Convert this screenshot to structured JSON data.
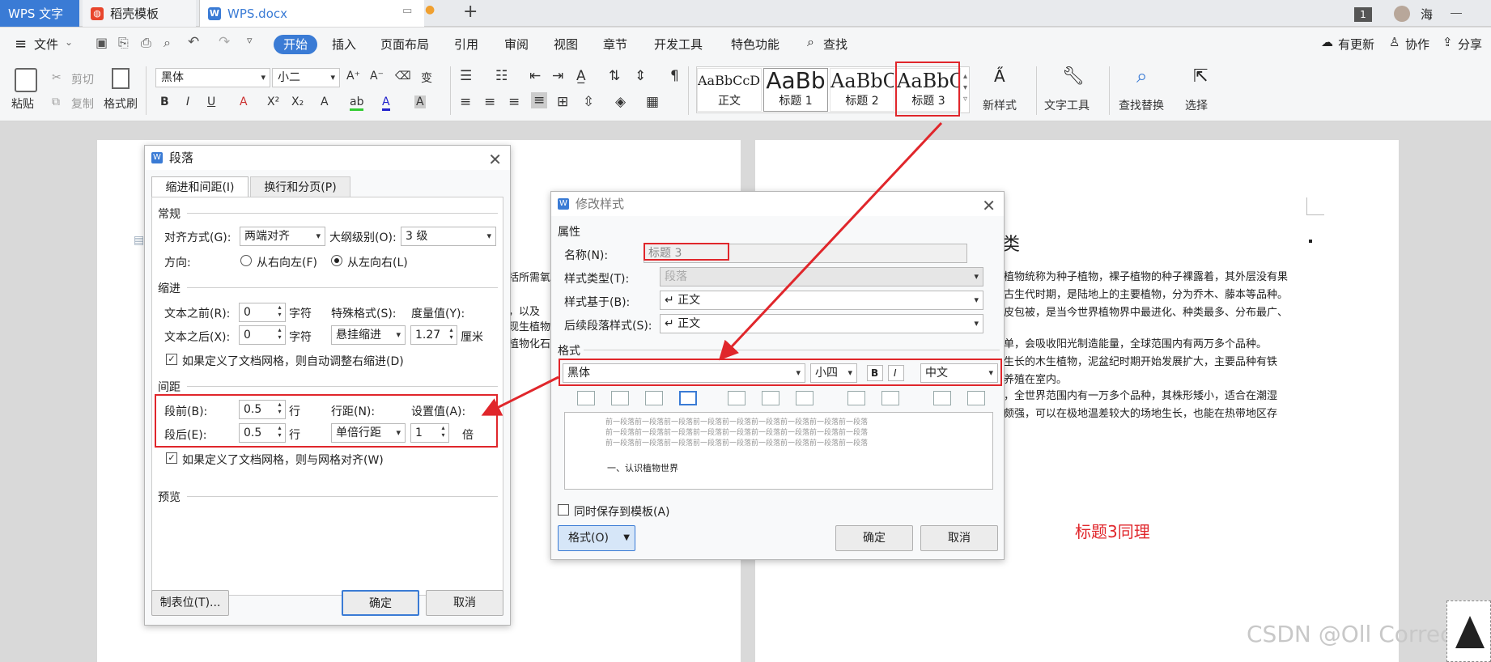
{
  "tabs": {
    "app": "WPS 文字",
    "template": "稻壳模板",
    "doc": "WPS.docx"
  },
  "titlebar": {
    "count": "1",
    "user": "海"
  },
  "menu": {
    "file": "文件",
    "items": [
      "开始",
      "插入",
      "页面布局",
      "引用",
      "审阅",
      "视图",
      "章节",
      "开发工具",
      "特色功能"
    ],
    "search": "查找",
    "update": "有更新",
    "collab": "协作",
    "share": "分享"
  },
  "ribbon": {
    "paste": "粘贴",
    "cut": "剪切",
    "copy": "复制",
    "format_painter": "格式刷",
    "font": "黑体",
    "size": "小二",
    "styles": [
      {
        "preview": "AaBbCcDd",
        "label": "正文"
      },
      {
        "preview": "AaBb",
        "label": "标题 1"
      },
      {
        "preview": "AaBbC",
        "label": "标题 2"
      },
      {
        "preview": "AaBbC",
        "label": "标题 3"
      }
    ],
    "new_style": "新样式",
    "text_tool": "文字工具",
    "find_replace": "查找替换",
    "select": "选择"
  },
  "para_dialog": {
    "title": "段落",
    "tab1": "缩进和间距(I)",
    "tab2": "换行和分页(P)",
    "general": "常规",
    "align_label": "对齐方式(G):",
    "align_value": "两端对齐",
    "outline_label": "大纲级别(O):",
    "outline_value": "3 级",
    "direction_label": "方向:",
    "rtl": "从右向左(F)",
    "ltr": "从左向右(L)",
    "indent": "缩进",
    "before_text": "文本之前(R):",
    "before_text_val": "0",
    "unit_char": "字符",
    "special_label": "特殊格式(S):",
    "special_value": "悬挂缩进",
    "measure_label": "度量值(Y):",
    "measure_value": "1.27",
    "unit_cm": "厘米",
    "after_text": "文本之后(X):",
    "after_text_val": "0",
    "grid_indent": "如果定义了文档网格，则自动调整右缩进(D)",
    "spacing": "间距",
    "before": "段前(B):",
    "before_val": "0.5",
    "unit_line": "行",
    "line_spacing_label": "行距(N):",
    "set_value_label": "设置值(A):",
    "after": "段后(E):",
    "after_val": "0.5",
    "line_spacing_value": "单倍行距",
    "set_value": "1",
    "unit_times": "倍",
    "grid_align": "如果定义了文档网格，则与网格对齐(W)",
    "preview": "预览",
    "tabs_btn": "制表位(T)...",
    "ok": "确定",
    "cancel": "取消"
  },
  "style_dialog": {
    "title": "修改样式",
    "props": "属性",
    "name_label": "名称(N):",
    "name_value": "标题 3",
    "type_label": "样式类型(T):",
    "type_value": "段落",
    "based_label": "样式基于(B):",
    "based_value": "↵ 正文",
    "next_label": "后续段落样式(S):",
    "next_value": "↵ 正文",
    "format": "格式",
    "font": "黑体",
    "size": "小四",
    "bold": "B",
    "italic": "I",
    "lang": "中文",
    "preview_prev": "前一段落前一段落前一段落前一段落前一段落前一段落前一段落前一段落前一段落",
    "preview_text": "一、认识植物世界",
    "save_tpl": "同时保存到模板(A)",
    "format_btn": "格式(O)",
    "ok": "确定",
    "cancel": "取消"
  },
  "doc_left": [
    "括所需氧",
    "，以及",
    "现生植物",
    "植物化石"
  ],
  "doc_right": {
    "heading": "类",
    "lines": [
      "植物统称为种子植物，裸子植物的种子裸露着，其外层没有果",
      "古生代时期，是陆地上的主要植物，分为乔木、藤本等品种。",
      "皮包被，是当今世界植物界中最进化、种类最多、分布最广、",
      "单，会吸收阳光制造能量，全球范围内有两万多个品种。",
      "生长的木生植物，泥盆纪时期开始发展扩大，主要品种有铁",
      "",
      "，全世界范围内有一万多个品种，其株形矮小，适合在潮湿",
      "颇强，可以在极地温差较大的场地生长，也能在热带地区存",
      "养殖在室内。"
    ],
    "note": "标题3同理"
  },
  "watermark": "CSDN @Oll Correct",
  "colors": {
    "accent": "#3a7bd5",
    "annotation": "#e0262b"
  }
}
